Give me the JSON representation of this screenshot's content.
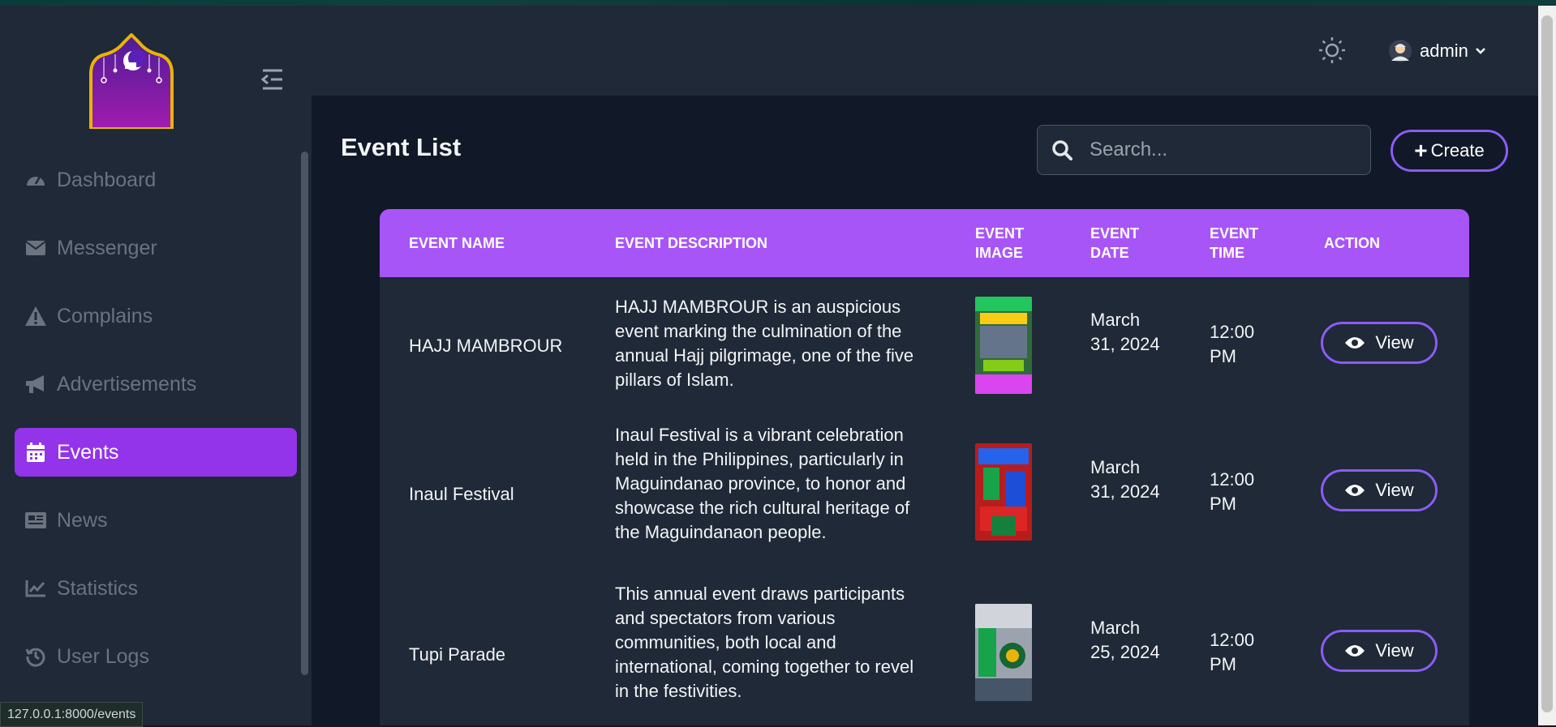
{
  "sidebar": {
    "items": [
      {
        "label": "Dashboard",
        "icon": "dashboard-gauge-icon"
      },
      {
        "label": "Messenger",
        "icon": "envelope-icon"
      },
      {
        "label": "Complains",
        "icon": "warning-icon"
      },
      {
        "label": "Advertisements",
        "icon": "megaphone-icon"
      },
      {
        "label": "Events",
        "icon": "calendar-icon",
        "active": true
      },
      {
        "label": "News",
        "icon": "newspaper-icon"
      },
      {
        "label": "Statistics",
        "icon": "chart-line-icon"
      },
      {
        "label": "User Logs",
        "icon": "history-icon"
      }
    ]
  },
  "header": {
    "user": "admin"
  },
  "main": {
    "title": "Event List",
    "search_placeholder": "Search...",
    "create_label": "Create"
  },
  "table": {
    "headers": {
      "name": "EVENT NAME",
      "description": "EVENT DESCRIPTION",
      "image_1": "EVENT",
      "image_2": "IMAGE",
      "date_1": "EVENT",
      "date_2": "DATE",
      "time_1": "EVENT",
      "time_2": "TIME",
      "action": "ACTION"
    },
    "rows": [
      {
        "name": "HAJJ MAMBROUR",
        "description": "HAJJ MAMBROUR is an auspicious event marking the culmination of the annual Hajj pilgrimage, one of the five pillars of Islam.",
        "date": "March 31, 2024",
        "time": "12:00 PM",
        "action": "View"
      },
      {
        "name": "Inaul Festival",
        "description": "Inaul Festival is a vibrant celebration held in the Philippines, particularly in Maguindanao province, to honor and showcase the rich cultural heritage of the Maguindanaon people.",
        "date": "March 31, 2024",
        "time": "12:00 PM",
        "action": "View"
      },
      {
        "name": "Tupi Parade",
        "description": "This annual event draws participants and spectators from various communities, both local and international, coming together to revel in the festivities.",
        "date": "March 25, 2024",
        "time": "12:00 PM",
        "action": "View"
      }
    ]
  },
  "status_bar": {
    "url": "127.0.0.1:8000/events"
  },
  "colors": {
    "accent": "#9333ea",
    "table_header": "#a855f7",
    "button_border": "#8b5cf6",
    "background": "#111827",
    "panel": "#1f2937"
  }
}
